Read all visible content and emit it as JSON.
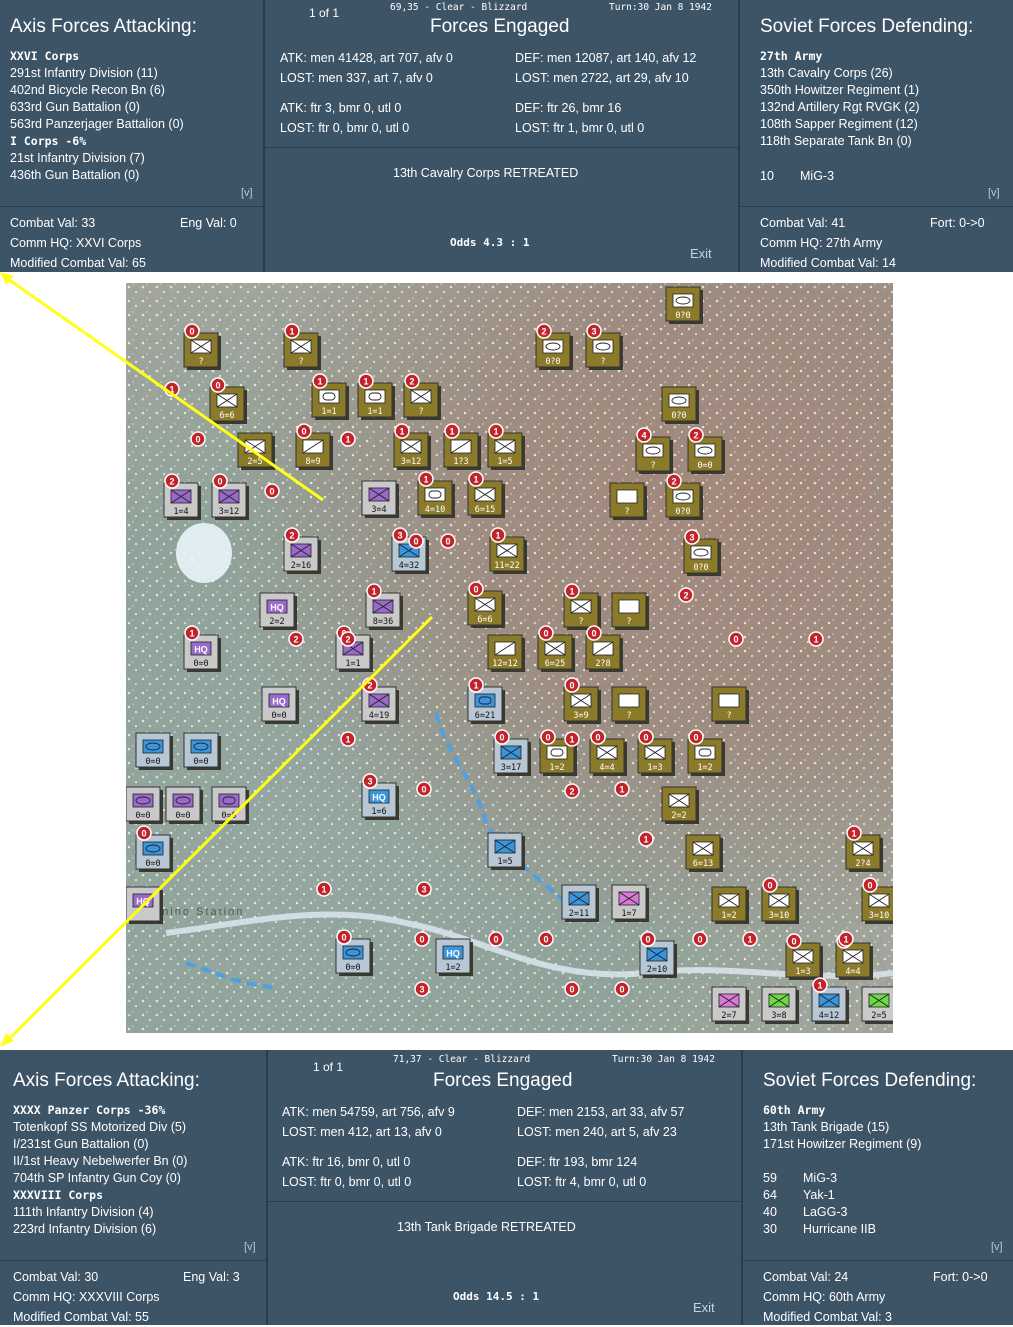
{
  "top_report": {
    "header_left": "1 of 1",
    "location_weather": "69,35 - Clear - Blizzard",
    "turn": "Turn:30  Jan 8 1942",
    "attacker_title": "Axis Forces Attacking:",
    "center_title": "Forces Engaged",
    "defender_title": "Soviet Forces Defending:",
    "attacker_units": [
      {
        "text": "XXVI Corps",
        "corps": true
      },
      {
        "text": "291st Infantry Division (11)",
        "corps": false
      },
      {
        "text": "402nd Bicycle Recon Bn (6)",
        "corps": false
      },
      {
        "text": "633rd Gun Battalion (0)",
        "corps": false
      },
      {
        "text": "563rd Panzerjager Battalion (0)",
        "corps": false
      },
      {
        "text": "I Corps  -6%",
        "corps": true
      },
      {
        "text": "21st Infantry Division (7)",
        "corps": false
      },
      {
        "text": "436th Gun Battalion (0)",
        "corps": false
      }
    ],
    "defender_units": [
      {
        "text": "27th Army",
        "corps": true
      },
      {
        "text": "13th Cavalry Corps (26)",
        "corps": false
      },
      {
        "text": "350th Howitzer Regiment (1)",
        "corps": false
      },
      {
        "text": "132nd Artillery Rgt RVGK (2)",
        "corps": false
      },
      {
        "text": "108th Sapper Regiment (12)",
        "corps": false
      },
      {
        "text": "118th Separate Tank Bn (0)",
        "corps": false
      }
    ],
    "air_units": [
      {
        "count": "10",
        "name": "MiG-3"
      }
    ],
    "expand": "[v]",
    "atk_ground": "ATK: men 41428, art 707, afv 0",
    "atk_ground_lost": "LOST: men 337, art 7, afv 0",
    "def_ground": "DEF: men 12087, art 140, afv 12",
    "def_ground_lost": "LOST: men 2722, art 29, afv 10",
    "atk_air": "ATK: ftr 3, bmr 0, utl 0",
    "atk_air_lost": "LOST: ftr 0, bmr 0, utl 0",
    "def_air": "DEF: ftr 26, bmr 16",
    "def_air_lost": "LOST: ftr 1, bmr 0, utl 0",
    "result": "13th Cavalry Corps RETREATED",
    "odds": "Odds 4.3 : 1",
    "exit": "Exit",
    "atk_combat_val": "Combat Val: 33",
    "atk_eng_val": "Eng Val: 0",
    "atk_comm_hq": "Comm HQ: XXVI Corps",
    "atk_mod_combat": "Modified Combat Val: 65",
    "def_combat_val": "Combat Val: 41",
    "def_fort": "Fort: 0->0",
    "def_comm_hq": "Comm HQ: 27th Army",
    "def_mod_combat": "Modified Combat Val: 14"
  },
  "bottom_report": {
    "header_left": "1 of 1",
    "location_weather": "71,37 - Clear - Blizzard",
    "turn": "Turn:30  Jan 8 1942",
    "attacker_title": "Axis Forces Attacking:",
    "center_title": "Forces Engaged",
    "defender_title": "Soviet Forces Defending:",
    "attacker_units": [
      {
        "text": "XXXX Panzer Corps  -36%",
        "corps": true
      },
      {
        "text": "Totenkopf SS Motorized Div (5)",
        "corps": false
      },
      {
        "text": "I/231st Gun Battalion (0)",
        "corps": false
      },
      {
        "text": "II/1st Heavy Nebelwerfer Bn (0)",
        "corps": false
      },
      {
        "text": "704th SP Infantry Gun Coy (0)",
        "corps": false
      },
      {
        "text": "XXXVIII Corps",
        "corps": true
      },
      {
        "text": "111th Infantry Division (4)",
        "corps": false
      },
      {
        "text": "223rd Infantry Division (6)",
        "corps": false
      }
    ],
    "defender_units": [
      {
        "text": "60th Army",
        "corps": true
      },
      {
        "text": "13th Tank Brigade (15)",
        "corps": false
      },
      {
        "text": "171st Howitzer Regiment (9)",
        "corps": false
      }
    ],
    "air_units": [
      {
        "count": "59",
        "name": "MiG-3"
      },
      {
        "count": "64",
        "name": "Yak-1"
      },
      {
        "count": "40",
        "name": "LaGG-3"
      },
      {
        "count": "30",
        "name": "Hurricane IIB"
      }
    ],
    "expand": "[v]",
    "atk_ground": "ATK: men 54759, art 756, afv 9",
    "atk_ground_lost": "LOST: men 412, art 13, afv 0",
    "def_ground": "DEF: men 2153, art 33, afv 57",
    "def_ground_lost": "LOST: men 240, art 5, afv 23",
    "atk_air": "ATK: ftr 16, bmr 0, utl 0",
    "atk_air_lost": "LOST: ftr 0, bmr 0, utl 0",
    "def_air": "DEF: ftr 193, bmr 124",
    "def_air_lost": "LOST: ftr 4, bmr 0, utl 0",
    "result": "13th Tank Brigade RETREATED",
    "odds": "Odds 14.5 : 1",
    "exit": "Exit",
    "atk_combat_val": "Combat Val: 30",
    "atk_eng_val": "Eng Val: 3",
    "atk_comm_hq": "Comm HQ: XXXVIII Corps",
    "atk_mod_combat": "Modified Combat Val: 55",
    "def_combat_val": "Combat Val: 24",
    "def_fort": "Fort: 0->0",
    "def_comm_hq": "Comm HQ: 60th Army",
    "def_mod_combat": "Modified Combat Val: 3"
  },
  "map": {
    "place_label": "Lenino Station",
    "colors": {
      "german": "#b8b8b8",
      "finnish_purple": "#9a6acb",
      "soviet": "#7d6a1f",
      "blue": "#3a95dd",
      "green": "#6fd84a",
      "pink": "#d77ad6",
      "arrow": "#ffff1a"
    },
    "units": [
      {
        "type": "cav",
        "val": "0?0",
        "side": "soviet"
      },
      {
        "type": "inf",
        "val": "?",
        "side": "soviet",
        "n": "0"
      },
      {
        "type": "inf",
        "val": "?",
        "side": "soviet",
        "n": "1"
      },
      {
        "type": "cav",
        "val": "0?0",
        "side": "soviet",
        "n": "2"
      },
      {
        "type": "cav",
        "val": "?",
        "side": "soviet",
        "n": "3"
      },
      {
        "type": "inf",
        "val": "6=6",
        "side": "soviet",
        "n": "0"
      },
      {
        "type": "arm",
        "val": "1=1",
        "side": "soviet",
        "n": "1"
      },
      {
        "type": "arm",
        "val": "1=1",
        "side": "soviet",
        "n": "1"
      },
      {
        "type": "inf",
        "val": "?",
        "side": "soviet",
        "n": "2"
      },
      {
        "type": "cav",
        "val": "0?0",
        "side": "soviet"
      },
      {
        "type": "inf",
        "val": "2=5",
        "side": "soviet"
      },
      {
        "type": "art",
        "val": "8=9",
        "side": "soviet",
        "n": "0"
      },
      {
        "type": "inf",
        "val": "3=12",
        "side": "soviet",
        "n": "1"
      },
      {
        "type": "art",
        "val": "1?3",
        "side": "soviet",
        "n": "1"
      },
      {
        "type": "inf",
        "val": "1=5",
        "side": "soviet",
        "n": "1"
      },
      {
        "type": "cav",
        "val": "?",
        "side": "soviet",
        "n": "4"
      },
      {
        "type": "cav",
        "val": "0=0",
        "side": "soviet",
        "n": "2"
      },
      {
        "type": "inf",
        "val": "1=4",
        "side": "german",
        "n": "2"
      },
      {
        "type": "inf",
        "val": "3=12",
        "side": "german",
        "n": "0"
      },
      {
        "type": "inf",
        "val": "3=4",
        "side": "german"
      },
      {
        "type": "arm",
        "val": "4=10",
        "side": "soviet",
        "n": "1"
      },
      {
        "type": "inf",
        "val": "6=15",
        "side": "soviet",
        "n": "1"
      },
      {
        "type": "box",
        "val": "?",
        "side": "soviet"
      },
      {
        "type": "cav",
        "val": "0?0",
        "side": "soviet",
        "n": "2"
      },
      {
        "type": "inf",
        "val": "2=16",
        "side": "german",
        "n": "2"
      },
      {
        "type": "inf",
        "val": "4=32",
        "side": "blue",
        "n": "3"
      },
      {
        "type": "inf",
        "val": "11=22",
        "side": "soviet",
        "n": "1"
      },
      {
        "type": "cav",
        "val": "0?0",
        "side": "soviet",
        "n": "3"
      },
      {
        "type": "hq",
        "val": "2=2",
        "side": "german"
      },
      {
        "type": "inf",
        "val": "8=36",
        "side": "german",
        "n": "1"
      },
      {
        "type": "inf",
        "val": "6=6",
        "side": "soviet",
        "n": "0"
      },
      {
        "type": "inf",
        "val": "?",
        "side": "soviet",
        "n": "1"
      },
      {
        "type": "box",
        "val": "?",
        "side": "soviet"
      },
      {
        "type": "hq",
        "val": "0=0",
        "side": "german",
        "n": "1"
      },
      {
        "type": "inf",
        "val": "1=1",
        "side": "german",
        "n": "0"
      },
      {
        "type": "art",
        "val": "12=12",
        "side": "soviet"
      },
      {
        "type": "inf",
        "val": "6=25",
        "side": "soviet",
        "n": "0"
      },
      {
        "type": "art",
        "val": "2?8",
        "side": "soviet",
        "n": "0"
      },
      {
        "type": "hq",
        "val": "0=0",
        "side": "german"
      },
      {
        "type": "inf",
        "val": "4=19",
        "side": "german",
        "n": "2"
      },
      {
        "type": "arm",
        "val": "6=21",
        "side": "blue",
        "n": "1"
      },
      {
        "type": "inf",
        "val": "3=9",
        "side": "soviet",
        "n": "0"
      },
      {
        "type": "box",
        "val": "?",
        "side": "soviet"
      },
      {
        "type": "box",
        "val": "?",
        "side": "soviet"
      },
      {
        "type": "cav",
        "val": "0=0",
        "side": "blue"
      },
      {
        "type": "cav",
        "val": "0=0",
        "side": "blue"
      },
      {
        "type": "inf",
        "val": "3=17",
        "side": "blue",
        "n": "0"
      },
      {
        "type": "arm",
        "val": "1=2",
        "side": "soviet",
        "n": "0"
      },
      {
        "type": "inf",
        "val": "4=4",
        "side": "soviet",
        "n": "0"
      },
      {
        "type": "inf",
        "val": "1=3",
        "side": "soviet",
        "n": "0"
      },
      {
        "type": "arm",
        "val": "1=2",
        "side": "soviet",
        "n": "0"
      },
      {
        "type": "cav",
        "val": "0=0",
        "side": "german"
      },
      {
        "type": "cav",
        "val": "0=0",
        "side": "german"
      },
      {
        "type": "arm",
        "val": "0=0",
        "side": "german"
      },
      {
        "type": "hq",
        "val": "1=6",
        "side": "blue",
        "n": "3"
      },
      {
        "type": "inf",
        "val": "2=2",
        "side": "soviet"
      },
      {
        "type": "cav",
        "val": "0=0",
        "side": "blue",
        "n": "0"
      },
      {
        "type": "inf",
        "val": "1=5",
        "side": "blue"
      },
      {
        "type": "inf",
        "val": "6=13",
        "side": "soviet"
      },
      {
        "type": "inf",
        "val": "2?4",
        "side": "soviet",
        "n": "1"
      },
      {
        "type": "hq",
        "val": "",
        "side": "german"
      },
      {
        "type": "inf",
        "val": "2=11",
        "side": "blue"
      },
      {
        "type": "inf",
        "val": "1=7",
        "side": "pink"
      },
      {
        "type": "inf",
        "val": "1=2",
        "side": "soviet"
      },
      {
        "type": "inf",
        "val": "3=10",
        "side": "soviet",
        "n": "0"
      },
      {
        "type": "inf",
        "val": "3=10",
        "side": "soviet",
        "n": "0"
      },
      {
        "type": "cav",
        "val": "0=0",
        "side": "blue",
        "n": "0"
      },
      {
        "type": "hq",
        "val": "1=2",
        "side": "blue"
      },
      {
        "type": "inf",
        "val": "2=10",
        "side": "blue",
        "n": "0"
      },
      {
        "type": "inf",
        "val": "1=3",
        "side": "soviet",
        "n": "0"
      },
      {
        "type": "inf",
        "val": "4=4",
        "side": "soviet",
        "n": "0"
      },
      {
        "type": "inf",
        "val": "2=7",
        "side": "pink"
      },
      {
        "type": "inf",
        "val": "3=8",
        "side": "green"
      },
      {
        "type": "inf",
        "val": "4=12",
        "side": "blue",
        "n": "1"
      },
      {
        "type": "inf",
        "val": "2=5",
        "side": "green"
      }
    ],
    "markers": [
      "1",
      "0",
      "0",
      "1",
      "0",
      "0",
      "2",
      "2",
      "1",
      "0",
      "1",
      "1",
      "1",
      "3",
      "2",
      "1",
      "1",
      "0",
      "0",
      "0",
      "3",
      "0",
      "0",
      "0",
      "1",
      "1",
      "2",
      "0",
      "1"
    ]
  }
}
